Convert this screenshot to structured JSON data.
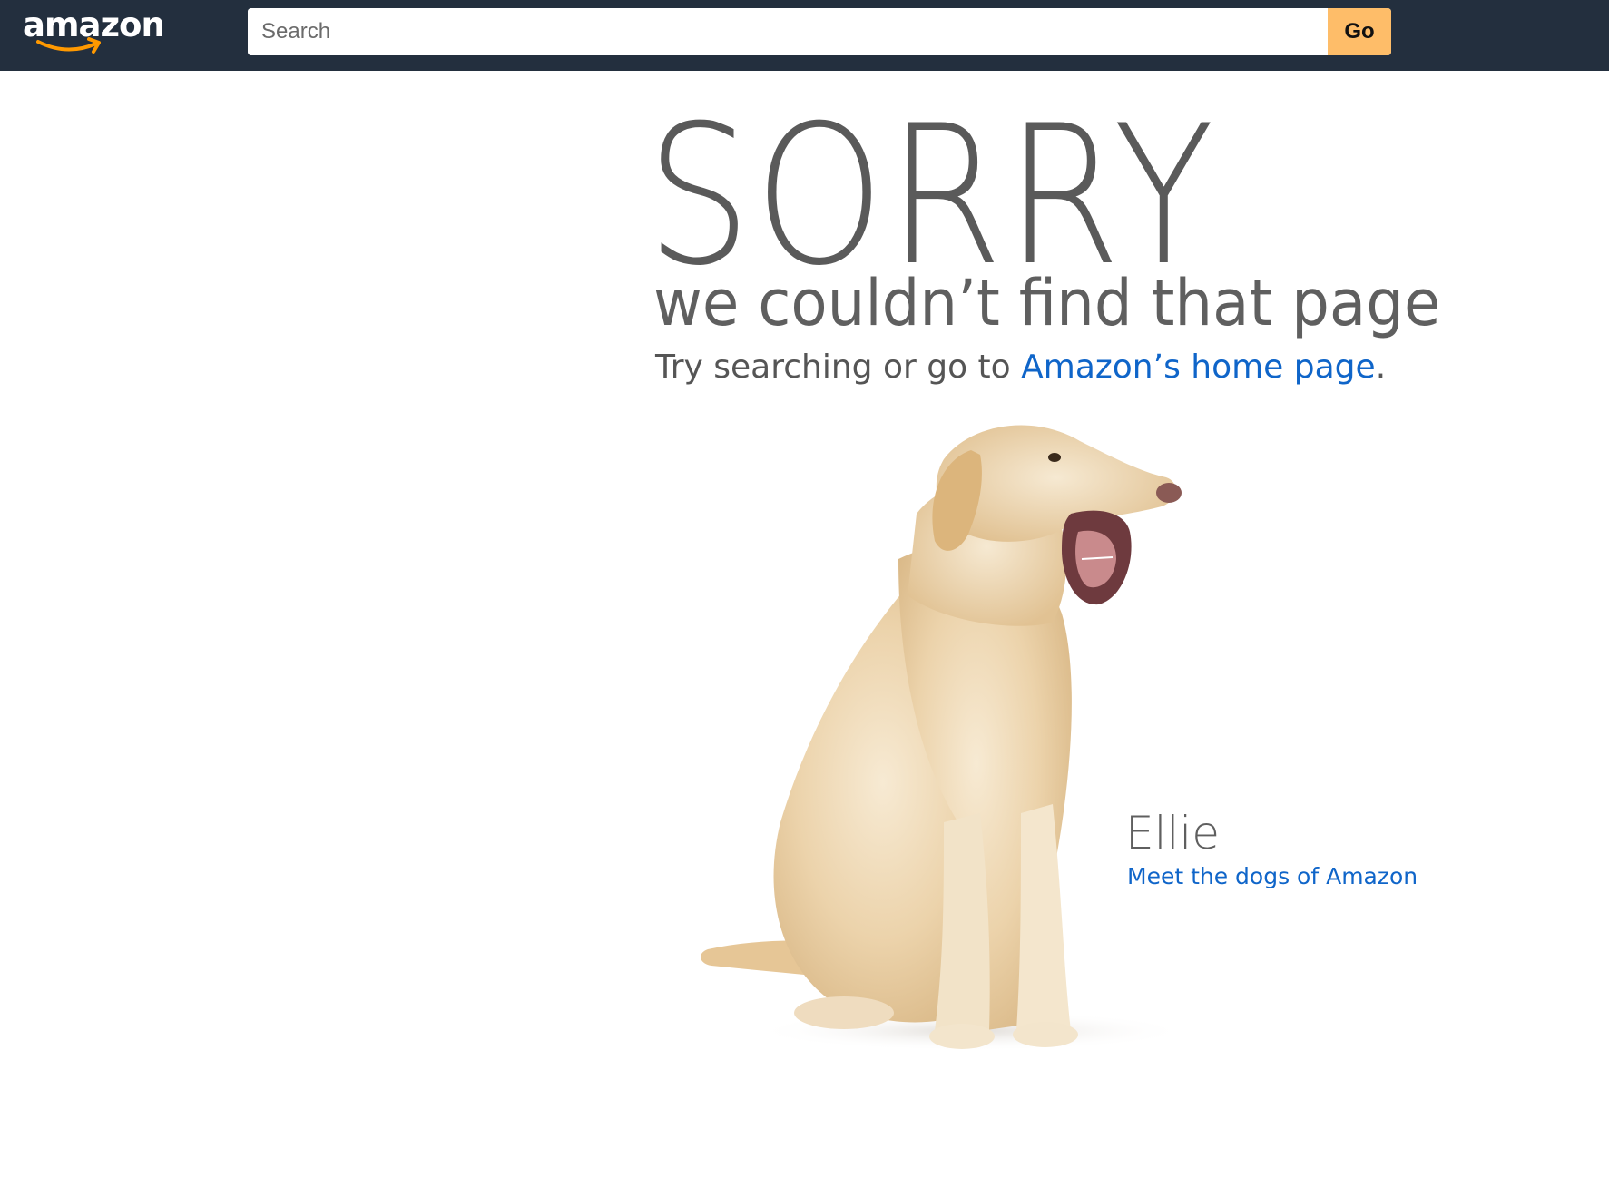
{
  "header": {
    "logo_text": "amazon",
    "search": {
      "placeholder": "Search",
      "value": ""
    },
    "go_label": "Go"
  },
  "main": {
    "headline": "SORRY",
    "subtitle": "we couldn’t find that page",
    "try_text": "Try searching or go to ",
    "home_link": "Amazon’s home page",
    "try_suffix": ".",
    "dog_name": "Ellie",
    "dogs_link": "Meet the dogs of Amazon"
  },
  "colors": {
    "header_bg": "#232f3e",
    "go_button": "#febd69",
    "link": "#0f65c9",
    "heading_text": "#5a5a5a"
  },
  "icons": {
    "logo_smile": "amazon-smile-arrow",
    "dog_photo": "yellow-labrador-yawning"
  }
}
